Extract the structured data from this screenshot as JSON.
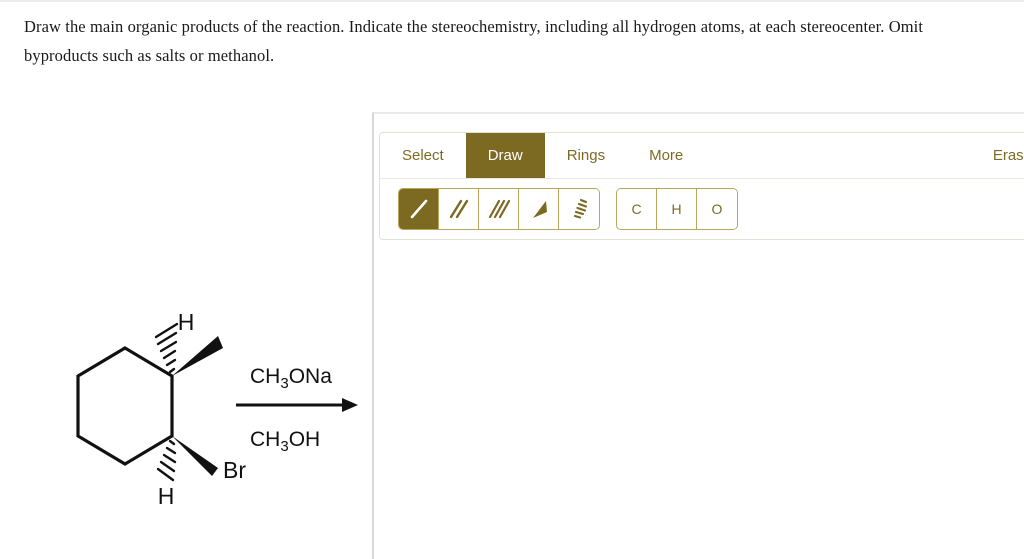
{
  "prompt": {
    "text": "Draw the main organic products of the reaction. Indicate the stereochemistry, including all hydrogen atoms, at each stereocenter. Omit byproducts such as salts or methanol."
  },
  "editor": {
    "accent_color": "#7d6a22",
    "border_color": "#b9a65a",
    "tabs": [
      {
        "label": "Select",
        "active": false
      },
      {
        "label": "Draw",
        "active": true
      },
      {
        "label": "Rings",
        "active": false
      },
      {
        "label": "More",
        "active": false
      }
    ],
    "erase_label": "Erase",
    "bond_tools": [
      {
        "name": "single-bond",
        "active": true
      },
      {
        "name": "double-bond",
        "active": false
      },
      {
        "name": "triple-bond",
        "active": false
      },
      {
        "name": "wedge-bond",
        "active": false
      },
      {
        "name": "hash-bond",
        "active": false
      }
    ],
    "element_buttons": [
      {
        "label": "C"
      },
      {
        "label": "H"
      },
      {
        "label": "O"
      }
    ]
  },
  "reaction": {
    "reagent_above": "CH",
    "reagent_above_sub": "3",
    "reagent_above_tail": "ONa",
    "reagent_below": "CH",
    "reagent_below_sub": "3",
    "reagent_below_tail": "OH",
    "substrate": {
      "ring": "cyclohexane",
      "top_stereocenter": {
        "hash_label": "H",
        "wedge_substituent": "methyl"
      },
      "bottom_stereocenter": {
        "hash_label": "H",
        "wedge_label": "Br"
      }
    }
  }
}
